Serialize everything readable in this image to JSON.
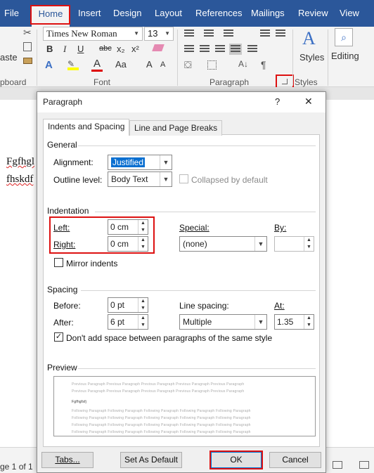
{
  "ribbon_tabs": [
    "File",
    "Home",
    "Insert",
    "Design",
    "Layout",
    "References",
    "Mailings",
    "Review",
    "View"
  ],
  "ribbon": {
    "clipboard": {
      "paste": "aste",
      "label": "pboard"
    },
    "font": {
      "name": "Times New Roman",
      "size": "13",
      "label": "Font",
      "bold": "B",
      "italic": "I",
      "underline": "U",
      "strike": "abc",
      "sub": "x₂",
      "sup": "x²",
      "grow": "A",
      "shrink": "A",
      "case": "Aa"
    },
    "paragraph": {
      "label": "Paragraph"
    },
    "styles": {
      "label": "Styles",
      "button": "Styles"
    },
    "editing": {
      "button": "Editing"
    }
  },
  "document": {
    "lines": [
      "Fgfhgl",
      "fhskdf"
    ]
  },
  "status": {
    "page": "ge 1 of 1"
  },
  "dialog": {
    "title": "Paragraph",
    "help": "?",
    "close": "✕",
    "tabs": [
      "Indents and Spacing",
      "Line and Page Breaks"
    ],
    "general": {
      "heading": "General",
      "alignment_label": "Alignment:",
      "alignment_value": "Justified",
      "outline_label": "Outline level:",
      "outline_value": "Body Text",
      "collapsed_label": "Collapsed by default"
    },
    "indentation": {
      "heading": "Indentation",
      "left_label": "Left:",
      "left_value": "0 cm",
      "right_label": "Right:",
      "right_value": "0 cm",
      "special_label": "Special:",
      "special_value": "(none)",
      "by_label": "By:",
      "by_value": "",
      "mirror_label": "Mirror indents"
    },
    "spacing": {
      "heading": "Spacing",
      "before_label": "Before:",
      "before_value": "0 pt",
      "after_label": "After:",
      "after_value": "6 pt",
      "line_label": "Line spacing:",
      "line_value": "Multiple",
      "at_label": "At:",
      "at_value": "1.35",
      "dont_add_label": "Don't add space between paragraphs of the same style"
    },
    "preview": {
      "heading": "Preview",
      "prev_text": "Previous Paragraph Previous Paragraph Previous Paragraph Previous Paragraph Previous Paragraph",
      "sample": "Fgfhgfsfj",
      "follow_text": "Following Paragraph Following Paragraph Following Paragraph Following Paragraph Following Paragraph"
    },
    "buttons": {
      "tabs": "Tabs...",
      "default": "Set As Default",
      "ok": "OK",
      "cancel": "Cancel"
    }
  }
}
